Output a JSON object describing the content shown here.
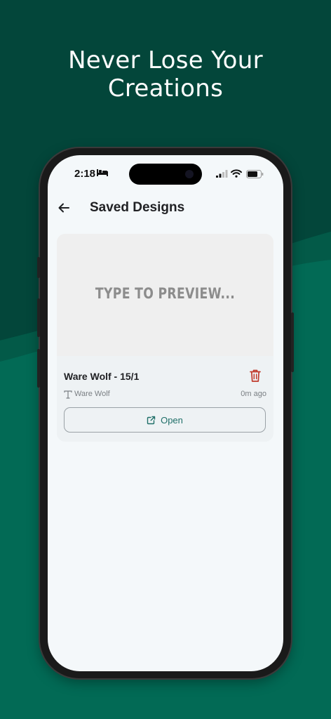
{
  "promo": {
    "headline_line1": "Never Lose Your",
    "headline_line2": "Creations"
  },
  "status_bar": {
    "time": "2:18"
  },
  "header": {
    "title": "Saved Designs"
  },
  "designs": [
    {
      "preview_text": "TYPE TO PREVIEW...",
      "name": "Ware Wolf - 15/1",
      "font": "Ware Wolf",
      "time_ago": "0m ago",
      "open_label": "Open"
    }
  ],
  "colors": {
    "background": "#026a55",
    "background_dark": "#03463a",
    "accent": "#1f6f68",
    "delete": "#c0392b"
  },
  "icons": [
    "back-arrow-icon",
    "bed-icon",
    "signal-icon",
    "wifi-icon",
    "battery-icon",
    "trash-icon",
    "font-t-icon",
    "external-link-icon"
  ]
}
